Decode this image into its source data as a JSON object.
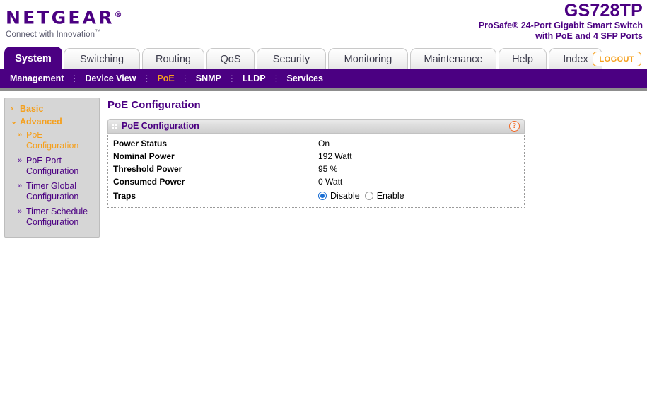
{
  "brand": {
    "name": "NETGEAR",
    "trademark": "®",
    "tagline": "Connect with Innovation",
    "tagline_trademark": "™"
  },
  "product": {
    "model": "GS728TP",
    "description_line1": "ProSafe® 24-Port Gigabit Smart Switch",
    "description_line2": "with PoE and 4 SFP Ports"
  },
  "tabs": [
    {
      "label": "System",
      "active": true
    },
    {
      "label": "Switching",
      "active": false
    },
    {
      "label": "Routing",
      "active": false
    },
    {
      "label": "QoS",
      "active": false
    },
    {
      "label": "Security",
      "active": false
    },
    {
      "label": "Monitoring",
      "active": false
    },
    {
      "label": "Maintenance",
      "active": false
    },
    {
      "label": "Help",
      "active": false
    },
    {
      "label": "Index",
      "active": false
    }
  ],
  "logout_label": "LOGOUT",
  "subnav": {
    "separator": "⋮",
    "items": [
      {
        "label": "Management",
        "active": false
      },
      {
        "label": "Device View",
        "active": false
      },
      {
        "label": "PoE",
        "active": true
      },
      {
        "label": "SNMP",
        "active": false
      },
      {
        "label": "LLDP",
        "active": false
      },
      {
        "label": "Services",
        "active": false
      }
    ]
  },
  "sidebar": {
    "top_items": [
      {
        "label": "Basic",
        "arrow": "›",
        "expanded": false
      },
      {
        "label": "Advanced",
        "arrow": "⌄",
        "expanded": true
      }
    ],
    "sub_items": [
      {
        "label": "PoE Configuration",
        "arrow": "»",
        "active": true
      },
      {
        "label": "PoE Port Configuration",
        "arrow": "»",
        "active": false
      },
      {
        "label": "Timer Global Configuration",
        "arrow": "»",
        "active": false
      },
      {
        "label": "Timer Schedule Configuration",
        "arrow": "»",
        "active": false
      }
    ]
  },
  "page": {
    "title": "PoE Configuration"
  },
  "panel": {
    "header_title": "PoE Configuration",
    "help_icon_glyph": "?",
    "fields": [
      {
        "label": "Power Status",
        "value": "On"
      },
      {
        "label": "Nominal Power",
        "value": "192 Watt"
      },
      {
        "label": "Threshold Power",
        "value": "95 %"
      },
      {
        "label": "Consumed Power",
        "value": "0 Watt"
      }
    ],
    "traps": {
      "label": "Traps",
      "options": [
        {
          "label": "Disable",
          "selected": true
        },
        {
          "label": "Enable",
          "selected": false
        }
      ]
    }
  },
  "colors": {
    "brand_purple": "#4b0082",
    "accent_orange": "#f5a01e",
    "help_orange": "#f26722",
    "radio_blue": "#1a6fd4"
  }
}
